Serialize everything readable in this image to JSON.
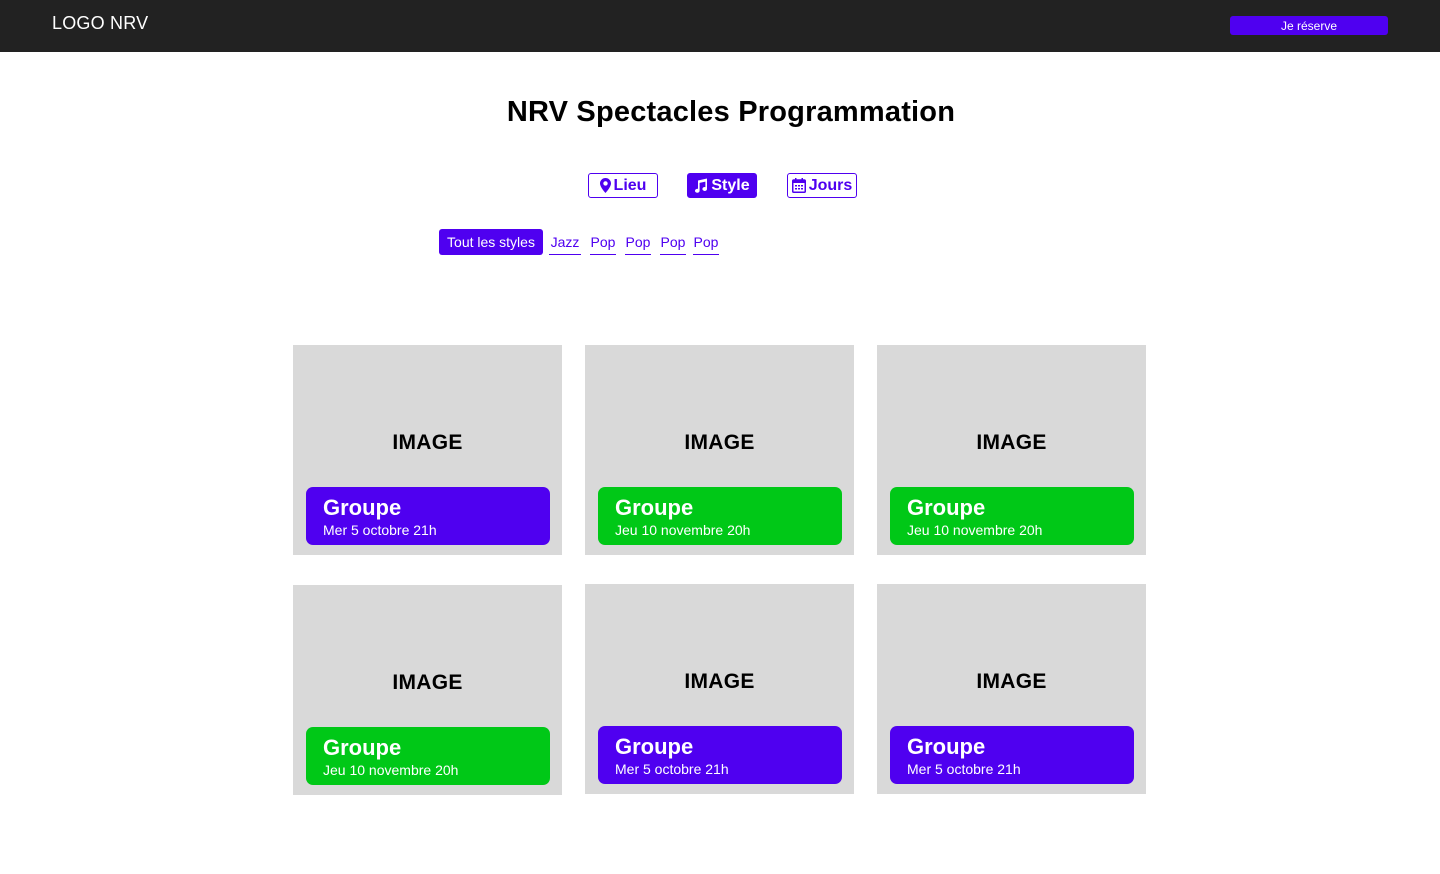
{
  "header": {
    "logo": "LOGO NRV",
    "reserve_label": "Je réserve"
  },
  "page": {
    "title": "NRV Spectacles Programmation"
  },
  "filters": [
    {
      "label": "Lieu",
      "icon": "map-pin-icon",
      "active": false
    },
    {
      "label": "Style",
      "icon": "music-note-icon",
      "active": true
    },
    {
      "label": "Jours",
      "icon": "calendar-icon",
      "active": false
    }
  ],
  "styles": [
    {
      "label": "Tout les styles",
      "active": true
    },
    {
      "label": "Jazz",
      "active": false
    },
    {
      "label": "Pop",
      "active": false
    },
    {
      "label": "Pop",
      "active": false
    },
    {
      "label": "Pop",
      "active": false
    },
    {
      "label": "Pop",
      "active": false
    }
  ],
  "events": [
    {
      "image": "IMAGE",
      "name": "Groupe",
      "date": "Mer 5 octobre 21h",
      "color": "#4f00f0"
    },
    {
      "image": "IMAGE",
      "name": "Groupe",
      "date": "Jeu 10 novembre 20h",
      "color": "#00c817"
    },
    {
      "image": "IMAGE",
      "name": "Groupe",
      "date": "Jeu 10 novembre 20h",
      "color": "#00c817"
    },
    {
      "image": "IMAGE",
      "name": "Groupe",
      "date": "Jeu 10 novembre 20h",
      "color": "#00c817"
    },
    {
      "image": "IMAGE",
      "name": "Groupe",
      "date": "Mer 5 octobre 21h",
      "color": "#4f00f0"
    },
    {
      "image": "IMAGE",
      "name": "Groupe",
      "date": "Mer 5 octobre 21h",
      "color": "#4f00f0"
    }
  ],
  "colors": {
    "accent": "#4f00f0",
    "green": "#00c817",
    "header_bg": "#222222",
    "placeholder_bg": "#d9d9d9"
  }
}
